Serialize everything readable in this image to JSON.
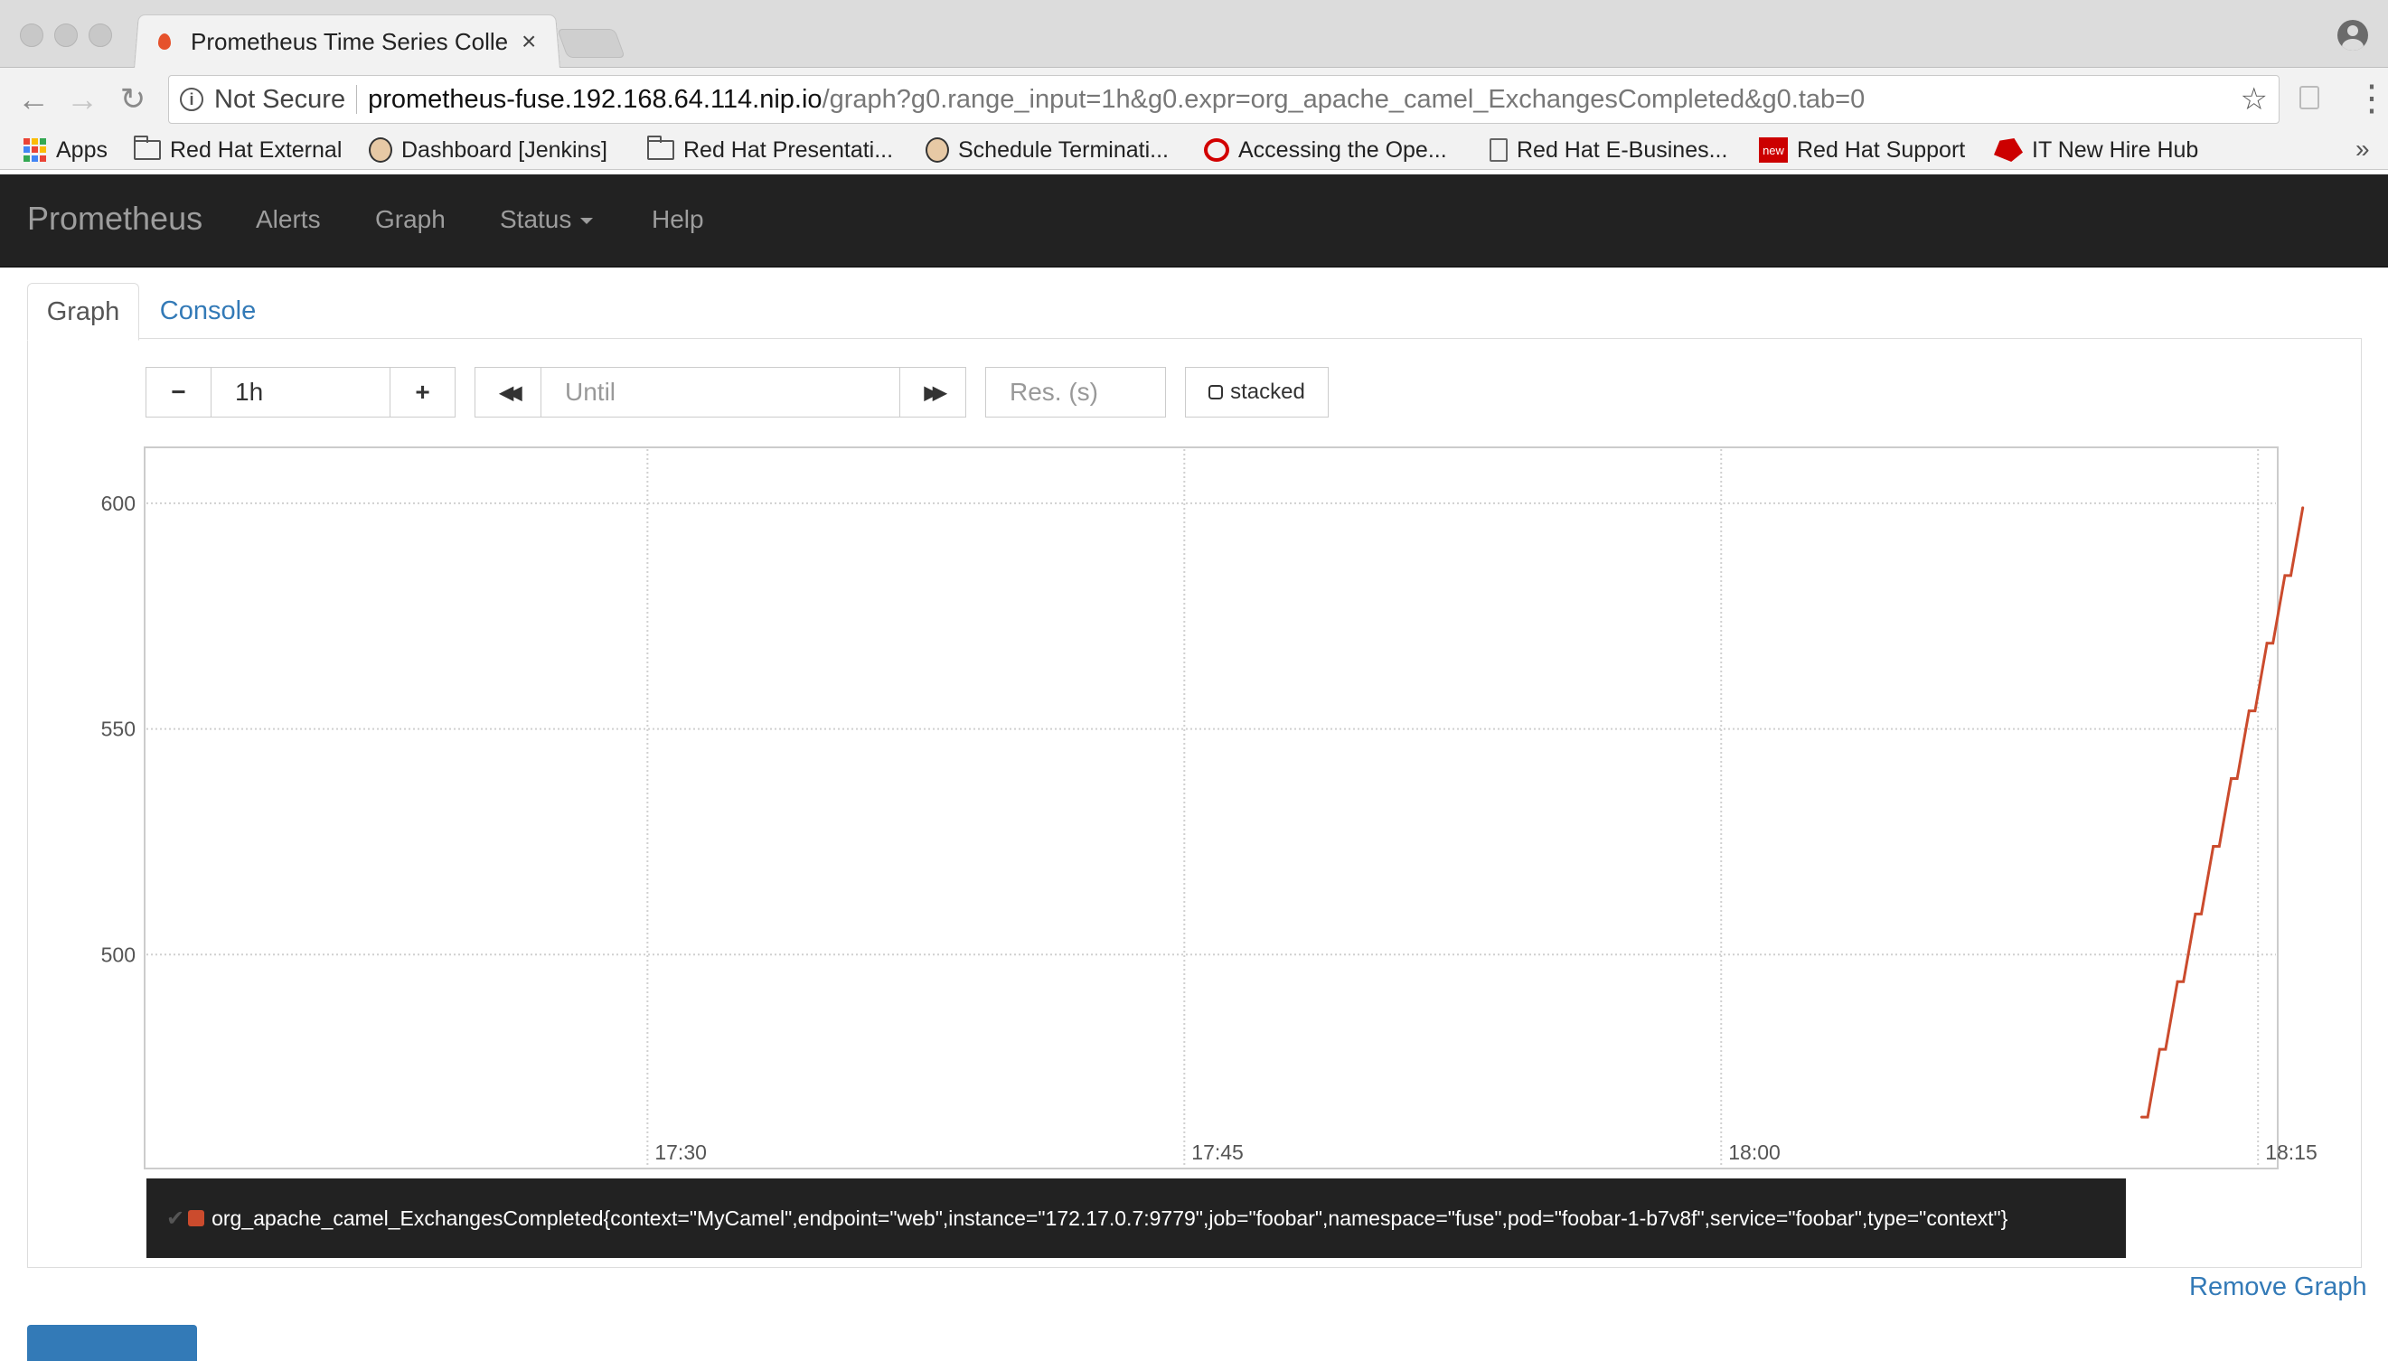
{
  "browser": {
    "tab_title": "Prometheus Time Series Collec",
    "tab_close": "×",
    "security_label": "Not Secure",
    "url_host": "prometheus-fuse.192.168.64.114.nip.io",
    "url_path": "/graph?g0.range_input=1h&g0.expr=org_apache_camel_ExchangesCompleted&g0.tab=0",
    "bookmarks": [
      {
        "label": "Apps",
        "icon": "apps-grid-icon"
      },
      {
        "label": "Red Hat External",
        "icon": "folder-icon"
      },
      {
        "label": "Dashboard [Jenkins]",
        "icon": "jenkins-icon"
      },
      {
        "label": "Red Hat Presentati...",
        "icon": "folder-icon"
      },
      {
        "label": "Schedule Terminati...",
        "icon": "jenkins-icon"
      },
      {
        "label": "Accessing the Ope...",
        "icon": "openshift-icon"
      },
      {
        "label": "Red Hat E-Busines...",
        "icon": "document-icon"
      },
      {
        "label": "Red Hat Support",
        "icon": "new-badge-icon"
      },
      {
        "label": "IT New Hire Hub",
        "icon": "redhat-hat-icon"
      }
    ],
    "new_badge_text": "new",
    "overflow_chevron": "»"
  },
  "navbar": {
    "brand": "Prometheus",
    "links": [
      "Alerts",
      "Graph",
      "Status",
      "Help"
    ]
  },
  "panel": {
    "tabs": [
      "Graph",
      "Console"
    ],
    "active_tab": "Graph",
    "controls": {
      "minus": "−",
      "range_value": "1h",
      "plus": "+",
      "back": "◀◀",
      "until_placeholder": "Until",
      "forward": "▶▶",
      "resolution_placeholder": "Res. (s)",
      "stacked_label": "stacked"
    },
    "legend_label": "org_apache_camel_ExchangesCompleted{context=\"MyCamel\",endpoint=\"web\",instance=\"172.17.0.7:9779\",job=\"foobar\",namespace=\"fuse\",pod=\"foobar-1-b7v8f\",service=\"foobar\",type=\"context\"}",
    "remove_graph": "Remove Graph"
  },
  "colors": {
    "navbar_bg": "#222222",
    "link": "#337ab7",
    "series": "#cb4b2d"
  },
  "chart_data": {
    "type": "line",
    "x_type": "time",
    "x_tick_labels": [
      "17:30",
      "17:45",
      "18:00",
      "18:15"
    ],
    "x_range": [
      "17:16:00",
      "18:15:30"
    ],
    "y_ticks": [
      500,
      550,
      600
    ],
    "ylim": [
      453,
      612
    ],
    "grid": true,
    "legend_position": "bottom",
    "series": [
      {
        "name": "org_apache_camel_ExchangesCompleted{context=\"MyCamel\",endpoint=\"web\",instance=\"172.17.0.7:9779\",job=\"foobar\",namespace=\"fuse\",pod=\"foobar-1-b7v8f\",service=\"foobar\",type=\"context\"}",
        "color": "#cb4b2d",
        "points": [
          [
            "18:11:45",
            464
          ],
          [
            "18:12:15",
            479
          ],
          [
            "18:12:45",
            494
          ],
          [
            "18:13:15",
            509
          ],
          [
            "18:13:45",
            524
          ],
          [
            "18:14:15",
            539
          ],
          [
            "18:14:45",
            554
          ],
          [
            "18:15:15",
            569
          ],
          [
            "18:15:45",
            584
          ],
          [
            "18:16:15",
            599
          ]
        ]
      }
    ]
  }
}
